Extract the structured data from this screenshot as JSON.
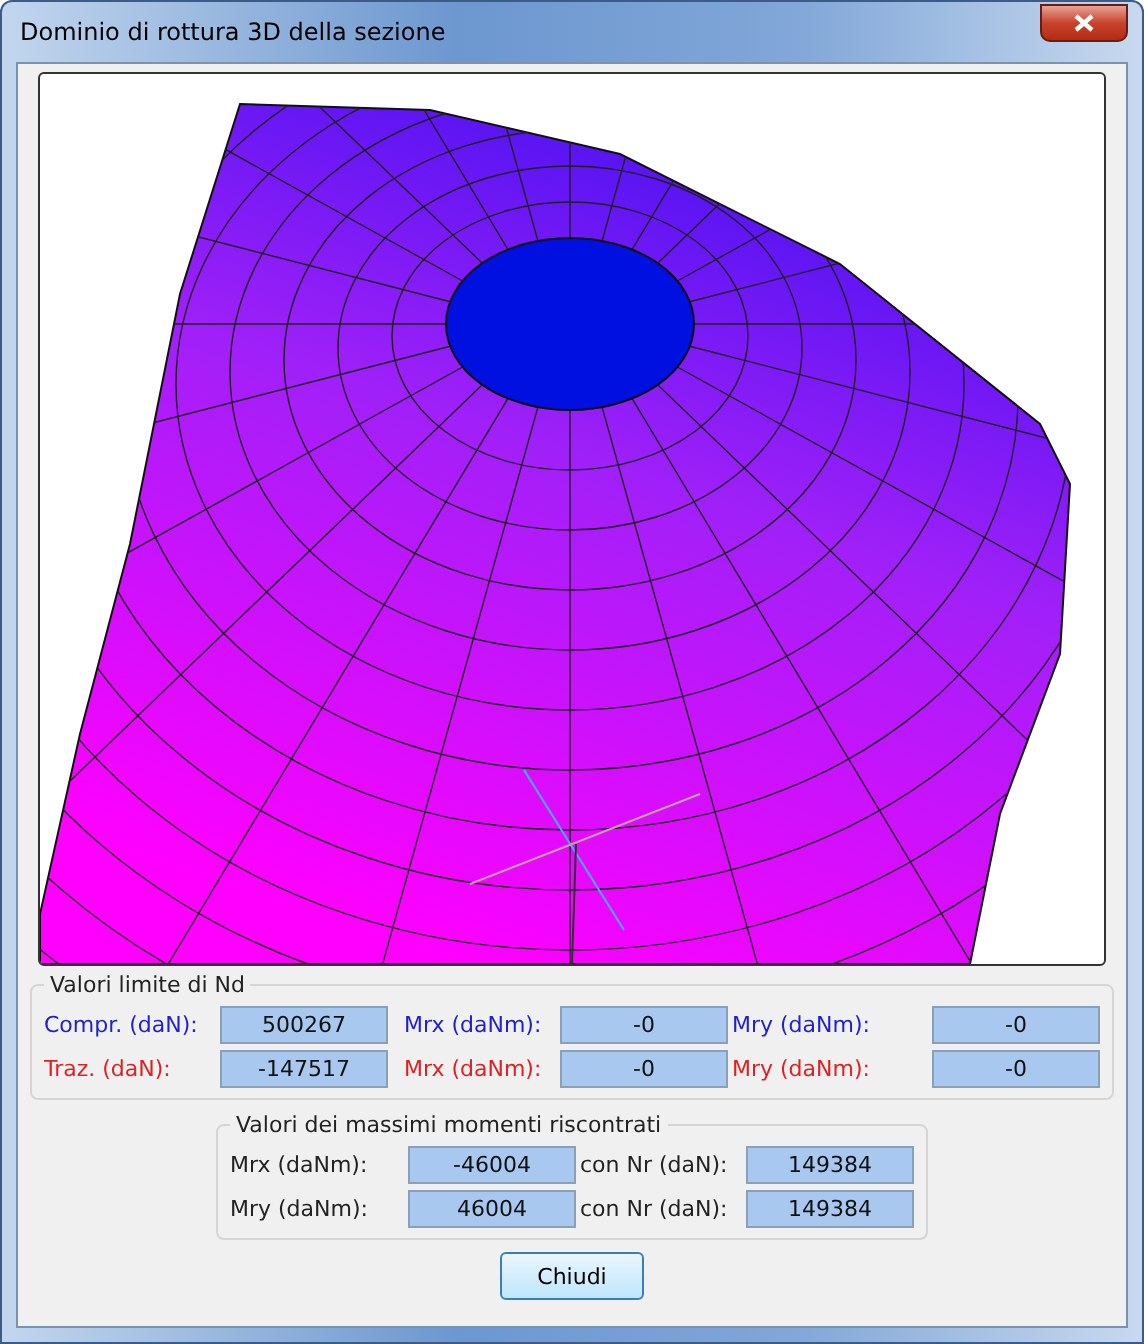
{
  "window": {
    "title": "Dominio di rottura 3D della sezione"
  },
  "limits": {
    "title": "Valori limite di Nd",
    "rows": [
      {
        "color": "#2222cc",
        "label": "Compr. (daN):",
        "value": "500267",
        "mrx_label": "Mrx (daNm):",
        "mrx": "-0",
        "mry_label": "Mry (daNm):",
        "mry": "-0"
      },
      {
        "color": "#dd2222",
        "label": "Traz. (daN):",
        "value": "-147517",
        "mrx_label": "Mrx (daNm):",
        "mrx": "-0",
        "mry_label": "Mry (daNm):",
        "mry": "-0"
      }
    ]
  },
  "maxima": {
    "title": "Valori dei massimi momenti riscontrati",
    "rows": [
      {
        "label": "Mrx (daNm):",
        "value": "-46004",
        "n_label": "con Nr (daN):",
        "n": "149384"
      },
      {
        "label": "Mry (daNm):",
        "value": "46004",
        "n_label": "con Nr (daN):",
        "n": "149384"
      }
    ]
  },
  "buttons": [
    "Chiudi"
  ]
}
